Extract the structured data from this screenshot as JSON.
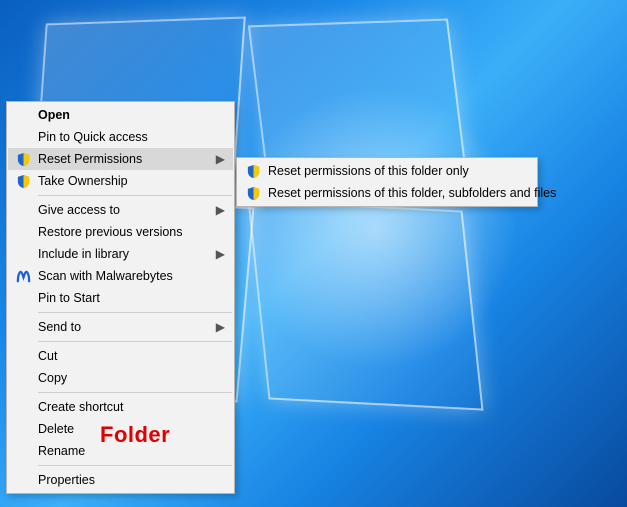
{
  "contextMenu": {
    "open": "Open",
    "pinQuickAccess": "Pin to Quick access",
    "resetPermissions": "Reset Permissions",
    "takeOwnership": "Take Ownership",
    "giveAccessTo": "Give access to",
    "restorePrevious": "Restore previous versions",
    "includeInLibrary": "Include in library",
    "scanMalwarebytes": "Scan with Malwarebytes",
    "pinToStart": "Pin to Start",
    "sendTo": "Send to",
    "cut": "Cut",
    "copy": "Copy",
    "createShortcut": "Create shortcut",
    "delete": "Delete",
    "rename": "Rename",
    "properties": "Properties"
  },
  "submenu": {
    "folderOnly": "Reset permissions of this folder only",
    "folderSubFiles": "Reset permissions of this folder, subfolders and files"
  },
  "annotation": {
    "folderLabel": "Folder"
  },
  "colors": {
    "highlight": "#d8d8d8",
    "menuBg": "#f2f2f2",
    "annotationRed": "#e00000"
  }
}
